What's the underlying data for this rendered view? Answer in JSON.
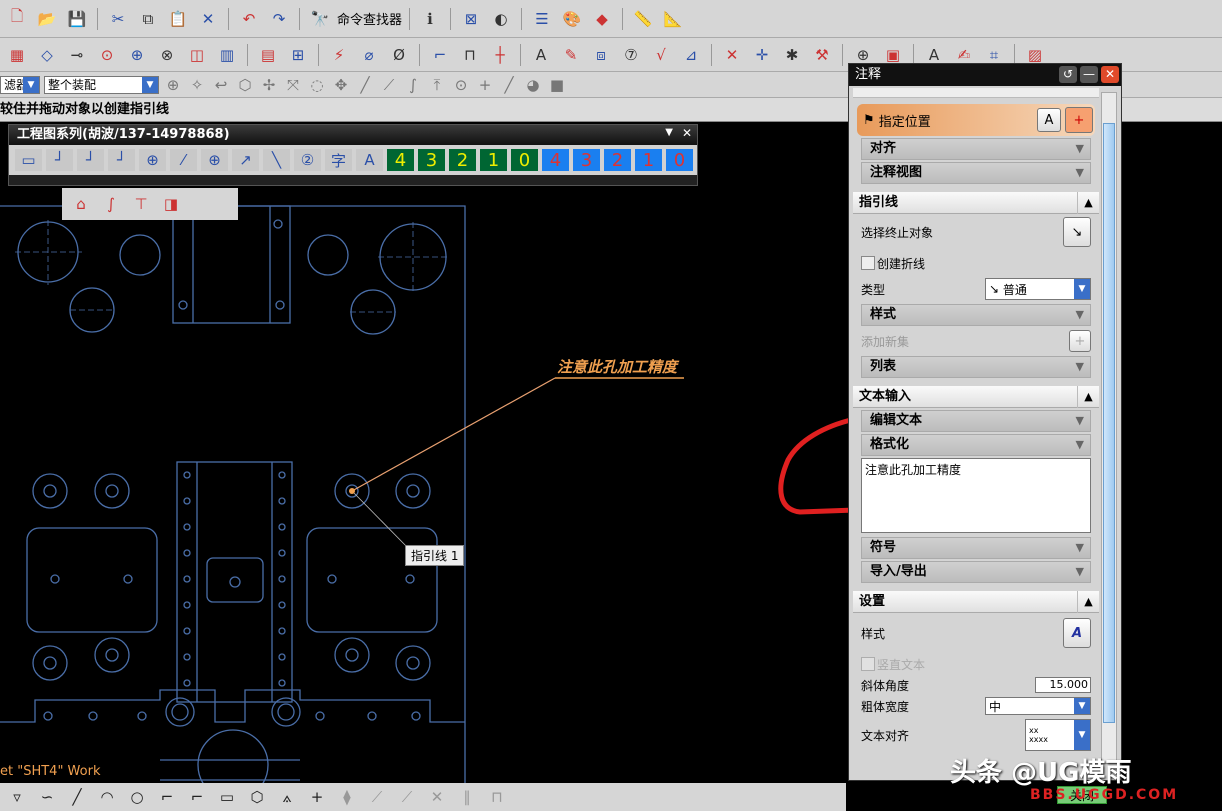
{
  "toolbar_row1": [
    {
      "icon": "new-file-icon",
      "g": "🗋"
    },
    {
      "icon": "open-folder-icon",
      "g": "📂"
    },
    {
      "icon": "save-icon",
      "g": "💾"
    },
    {
      "sep": true
    },
    {
      "icon": "cut-icon",
      "g": "✂"
    },
    {
      "icon": "copy-icon",
      "g": "⧉"
    },
    {
      "icon": "paste-icon",
      "g": "📋"
    },
    {
      "icon": "delete-icon",
      "g": "✕"
    },
    {
      "sep": true
    },
    {
      "icon": "undo-icon",
      "g": "↶"
    },
    {
      "icon": "redo-icon",
      "g": "↷"
    },
    {
      "sep": true
    },
    {
      "icon": "command-finder-icon",
      "g": "🔭",
      "label": "命令查找器"
    },
    {
      "sep": true
    },
    {
      "icon": "info-icon",
      "g": "ℹ"
    },
    {
      "sep": true
    },
    {
      "icon": "window-icon",
      "g": "⊠"
    },
    {
      "icon": "display-mode-icon",
      "g": "◐"
    },
    {
      "sep": true
    },
    {
      "icon": "layers-icon",
      "g": "☰"
    },
    {
      "icon": "palette-icon",
      "g": "🎨"
    },
    {
      "icon": "view-icon",
      "g": "◆"
    },
    {
      "sep": true
    },
    {
      "icon": "measure-icon",
      "g": "📏"
    },
    {
      "icon": "angle-measure-icon",
      "g": "📐"
    }
  ],
  "toolbar_row2": [
    {
      "icon": "new-sheet-icon",
      "g": "▦"
    },
    {
      "icon": "base-view-icon",
      "g": "◇"
    },
    {
      "icon": "projected-view-icon",
      "g": "⊸"
    },
    {
      "icon": "detail-view-icon",
      "g": "⊙"
    },
    {
      "icon": "section-view-icon",
      "g": "⊕"
    },
    {
      "icon": "half-section-icon",
      "g": "⊗"
    },
    {
      "icon": "revolved-section-icon",
      "g": "◫"
    },
    {
      "icon": "break-view-icon",
      "g": "▥"
    },
    {
      "sep": true
    },
    {
      "icon": "view-boundary-icon",
      "g": "▤"
    },
    {
      "icon": "display-settings-icon",
      "g": "⊞"
    },
    {
      "sep": true
    },
    {
      "icon": "dimension-icon",
      "g": "⚡"
    },
    {
      "icon": "cylinder-dim-icon",
      "g": "⌀"
    },
    {
      "icon": "hole-dim-icon",
      "g": "Ø"
    },
    {
      "sep": true
    },
    {
      "icon": "chamfer-icon",
      "g": "⌐"
    },
    {
      "icon": "ordinate-icon",
      "g": "⊓"
    },
    {
      "icon": "centerline-icon",
      "g": "┼"
    },
    {
      "sep": true
    },
    {
      "icon": "note-icon",
      "g": "A"
    },
    {
      "icon": "feature-control-icon",
      "g": "✎"
    },
    {
      "icon": "datum-icon",
      "g": "⧈"
    },
    {
      "icon": "balloon-icon",
      "g": "⑦"
    },
    {
      "icon": "surface-finish-icon",
      "g": "√"
    },
    {
      "icon": "weld-icon",
      "g": "⊿"
    },
    {
      "sep": true
    },
    {
      "icon": "intersection-icon",
      "g": "✕"
    },
    {
      "icon": "offset-center-icon",
      "g": "✛"
    },
    {
      "icon": "target-point-icon",
      "g": "✱"
    },
    {
      "icon": "hammer-icon",
      "g": "⚒"
    },
    {
      "sep": true
    },
    {
      "icon": "crosshair-icon",
      "g": "⊕"
    },
    {
      "icon": "image-icon",
      "g": "▣"
    },
    {
      "sep": true
    },
    {
      "icon": "text-style-icon",
      "g": "A"
    },
    {
      "icon": "edit-style-icon",
      "g": "✍"
    },
    {
      "icon": "region-icon",
      "g": "⌗"
    },
    {
      "sep": true
    },
    {
      "icon": "hatch-icon",
      "g": "▨"
    }
  ],
  "toolbar_row3": {
    "filter_value": "滤器",
    "assembly_value": "整个装配",
    "icons": [
      "selection-icon",
      "snap-icon",
      "arrow-icon",
      "cube-icon",
      "point-icon",
      "move-icon",
      "lasso-icon",
      "snap-point-icon",
      "line-end-icon",
      "mid-point-icon",
      "curve-icon",
      "intersect-icon",
      "center-icon",
      "cross-icon",
      "tangent-icon",
      "quadrant-icon",
      "solid-box-icon"
    ]
  },
  "status": {
    "prompt": "较住并拖动对象以创建指引线"
  },
  "floating_toolbar": {
    "title": "工程图系列(胡波/137-14978868)",
    "icons": [
      {
        "icon": "sheet-icon",
        "g": "▭"
      },
      {
        "icon": "ordinate-dim-icon",
        "g": "┘"
      },
      {
        "icon": "horizontal-dim-icon",
        "g": "┘"
      },
      {
        "icon": "vertical-dim-icon",
        "g": "┘"
      },
      {
        "icon": "xy-coordinate-icon",
        "g": "⊕"
      },
      {
        "icon": "chain-dim-icon",
        "g": "⁄"
      },
      {
        "icon": "circle-center-icon",
        "g": "⊕"
      },
      {
        "icon": "arrow-dim-icon",
        "g": "↗"
      },
      {
        "icon": "slope-icon",
        "g": "╲"
      },
      {
        "icon": "balloon-2-icon",
        "g": "②"
      },
      {
        "icon": "text-char-icon",
        "g": "字"
      },
      {
        "icon": "text-a-icon",
        "g": "A"
      }
    ],
    "numbers_green": [
      "4",
      "3",
      "2",
      "1",
      "0"
    ],
    "numbers_blue": [
      "4",
      "3",
      "2",
      "1",
      "0"
    ]
  },
  "sub_toolbar": [
    "contour-icon",
    "spline-icon",
    "stamp-icon",
    "view-3d-icon"
  ],
  "drawing": {
    "note_text": "注意此孔加工精度",
    "leader_label": "指引线 1",
    "sheet_status": "et \"SHT4\" Work"
  },
  "dialog": {
    "title": "注释",
    "origin": {
      "specify_location": "指定位置",
      "align": "对齐",
      "annotation_view": "注释视图"
    },
    "leader": {
      "title": "指引线",
      "select_terminating": "选择终止对象",
      "create_jog": "创建折线",
      "jog_checked": false,
      "type_label": "类型",
      "type_value": "普通",
      "style": "样式",
      "add_new_set": "添加新集",
      "list": "列表"
    },
    "text_input": {
      "title": "文本输入",
      "edit_text": "编辑文本",
      "formatting": "格式化",
      "text_value": "注意此孔加工精度",
      "symbols": "符号",
      "import_export": "导入/导出"
    },
    "settings": {
      "title": "设置",
      "style_label": "样式",
      "vertical_text": "竖直文本",
      "vertical_checked": false,
      "italic_angle_label": "斜体角度",
      "italic_angle_value": "15.000",
      "bold_width_label": "粗体宽度",
      "bold_width_value": "中",
      "text_align_label": "文本对齐",
      "close_label": "关闭"
    }
  },
  "bottom_toolbar": [
    "profile-icon",
    "line-icon",
    "arc-icon",
    "circle-icon",
    "fillet-icon",
    "chamfer-line-icon",
    "rectangle-icon",
    "polygon-icon",
    "spline-points-icon",
    "point-cross-icon",
    "constraint-icon",
    "trim-icon",
    "extend-icon",
    "quick-trim-icon",
    "parallel-icon",
    "dimension-box-icon",
    "mirror-icon"
  ],
  "watermark": {
    "text": "头条 @UG模雨",
    "site": "BBS.UGGD.COM"
  },
  "colors": {
    "canvas": "#000000",
    "geometry": "#4a6ea8",
    "annotation": "#f0a050",
    "highlight": "#e8a070",
    "markup": "#e02020"
  }
}
